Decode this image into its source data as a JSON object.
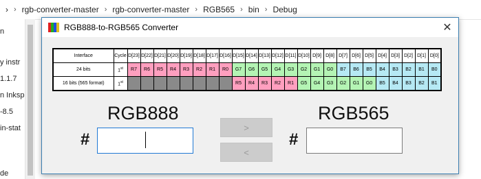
{
  "explorer": {
    "breadcrumb": [
      "rgb-converter-master",
      "rgb-converter-master",
      "RGB565",
      "bin",
      "Debug"
    ],
    "left_items": [
      "n",
      "y instr",
      "1.1.7",
      "n Inksp",
      "-8.5",
      "in-stat",
      "de"
    ]
  },
  "window": {
    "title": "RGB888-to-RGB565 Converter",
    "close_glyph": "✕",
    "icon_colors": [
      "#e02020",
      "#20b020",
      "#2050e0",
      "#e0c020"
    ]
  },
  "bit_table": {
    "header": [
      "Interface",
      "Cycle",
      "D[23]",
      "D[22]",
      "D[21]",
      "D[20]",
      "D[19]",
      "D[18]",
      "D[17]",
      "D[16]",
      "D[15]",
      "D[14]",
      "D[13]",
      "D[12]",
      "D[11]",
      "D[10]",
      "D[9]",
      "D[8]",
      "D[7]",
      "D[6]",
      "D[5]",
      "D[4]",
      "D[3]",
      "D[2]",
      "D[1]",
      "D[0]"
    ],
    "rows": [
      {
        "interface": "24 bits",
        "cycle": "1",
        "cycle_sup": "st",
        "cells": [
          {
            "t": "R7",
            "c": "r"
          },
          {
            "t": "R6",
            "c": "r"
          },
          {
            "t": "R5",
            "c": "r"
          },
          {
            "t": "R4",
            "c": "r"
          },
          {
            "t": "R3",
            "c": "r"
          },
          {
            "t": "R2",
            "c": "r"
          },
          {
            "t": "R1",
            "c": "r"
          },
          {
            "t": "R0",
            "c": "r"
          },
          {
            "t": "G7",
            "c": "g"
          },
          {
            "t": "G6",
            "c": "g"
          },
          {
            "t": "G5",
            "c": "g"
          },
          {
            "t": "G4",
            "c": "g"
          },
          {
            "t": "G3",
            "c": "g"
          },
          {
            "t": "G2",
            "c": "g"
          },
          {
            "t": "G1",
            "c": "g"
          },
          {
            "t": "G0",
            "c": "g"
          },
          {
            "t": "B7",
            "c": "b"
          },
          {
            "t": "B6",
            "c": "b"
          },
          {
            "t": "B5",
            "c": "b"
          },
          {
            "t": "B4",
            "c": "b"
          },
          {
            "t": "B3",
            "c": "b"
          },
          {
            "t": "B2",
            "c": "b"
          },
          {
            "t": "B1",
            "c": "b"
          },
          {
            "t": "B0",
            "c": "b"
          }
        ]
      },
      {
        "interface": "16 bits (565 format)",
        "cycle": "1",
        "cycle_sup": "st",
        "cells": [
          {
            "t": "",
            "c": "x"
          },
          {
            "t": "",
            "c": "x"
          },
          {
            "t": "",
            "c": "x"
          },
          {
            "t": "",
            "c": "x"
          },
          {
            "t": "",
            "c": "x"
          },
          {
            "t": "",
            "c": "x"
          },
          {
            "t": "",
            "c": "x"
          },
          {
            "t": "",
            "c": "x"
          },
          {
            "t": "R5",
            "c": "r"
          },
          {
            "t": "R4",
            "c": "r"
          },
          {
            "t": "R3",
            "c": "r"
          },
          {
            "t": "R2",
            "c": "r"
          },
          {
            "t": "R1",
            "c": "r"
          },
          {
            "t": "G5",
            "c": "g"
          },
          {
            "t": "G4",
            "c": "g"
          },
          {
            "t": "G3",
            "c": "g"
          },
          {
            "t": "G2",
            "c": "g"
          },
          {
            "t": "G1",
            "c": "g"
          },
          {
            "t": "G0",
            "c": "g"
          },
          {
            "t": "B5",
            "c": "b"
          },
          {
            "t": "B4",
            "c": "b"
          },
          {
            "t": "B3",
            "c": "b"
          },
          {
            "t": "B2",
            "c": "b"
          },
          {
            "t": "B1",
            "c": "b"
          }
        ]
      }
    ],
    "colors": {
      "r": "#ff9fbf",
      "g": "#b4f4b4",
      "b": "#b6e9f4",
      "x": "#8a8a8a"
    }
  },
  "left_panel": {
    "heading": "RGB888",
    "hash": "#",
    "input_value": ""
  },
  "right_panel": {
    "heading": "RGB565",
    "hash": "#",
    "input_value": ""
  },
  "buttons": {
    "to_565": ">",
    "to_888": "<"
  }
}
